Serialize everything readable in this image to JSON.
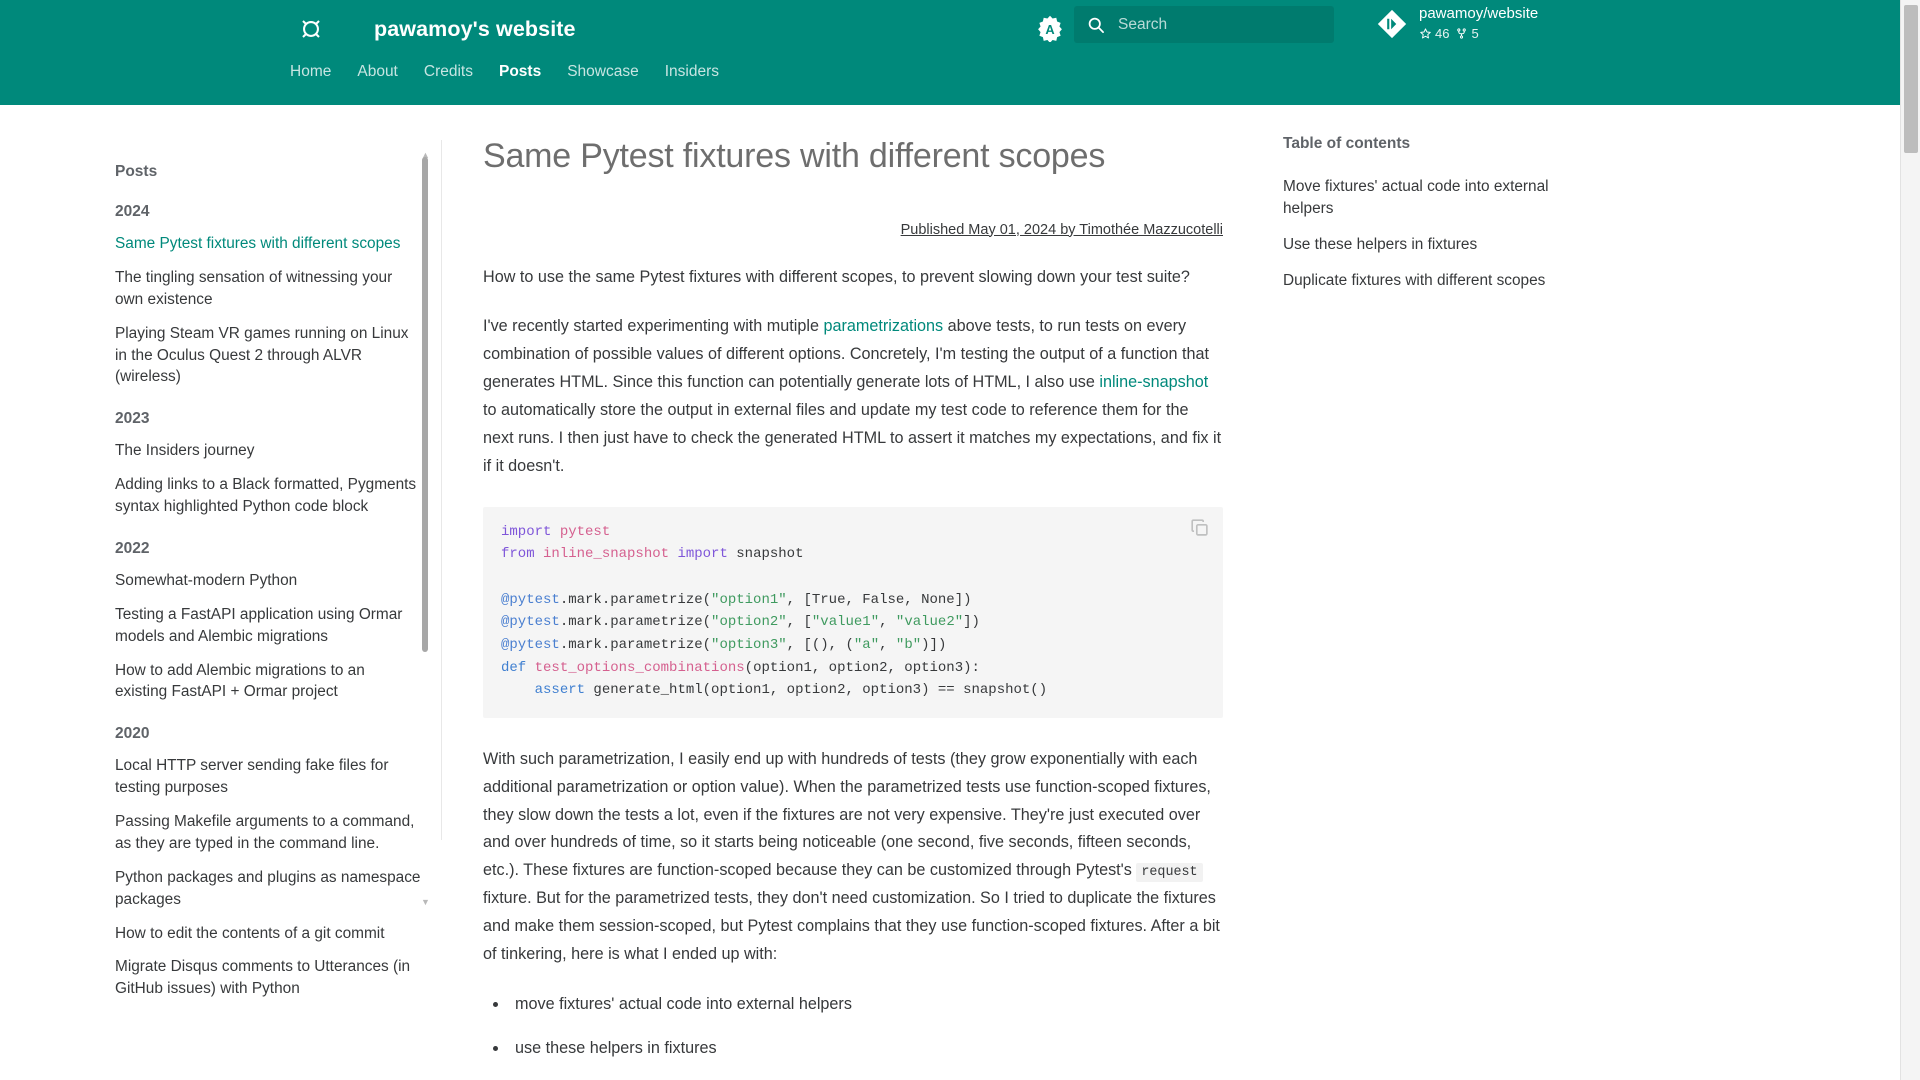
{
  "header": {
    "logo_icon": "site-logo-icon",
    "site_title": "pawamoy's website",
    "theme_toggle_icon": "brightness-auto-icon",
    "search": {
      "icon": "search-icon",
      "placeholder": "Search",
      "value": ""
    },
    "repo": {
      "icon": "git-icon",
      "name": "pawamoy/website",
      "stars_icon": "star-icon",
      "stars": "46",
      "forks_icon": "fork-icon",
      "forks": "5"
    },
    "nav": [
      {
        "label": "Home",
        "active": false
      },
      {
        "label": "About",
        "active": false
      },
      {
        "label": "Credits",
        "active": false
      },
      {
        "label": "Posts",
        "active": true
      },
      {
        "label": "Showcase",
        "active": false
      },
      {
        "label": "Insiders",
        "active": false
      }
    ]
  },
  "sidebar": {
    "title": "Posts",
    "groups": [
      {
        "year": "2024",
        "items": [
          {
            "label": "Same Pytest fixtures with different scopes",
            "current": true
          },
          {
            "label": "The tingling sensation of witnessing your own existence",
            "current": false
          },
          {
            "label": "Playing Steam VR games running on Linux in the Oculus Quest 2 through ALVR (wireless)",
            "current": false
          }
        ]
      },
      {
        "year": "2023",
        "items": [
          {
            "label": "The Insiders journey",
            "current": false
          },
          {
            "label": "Adding links to a Black formatted, Pygments syntax highlighted Python code block",
            "current": false
          }
        ]
      },
      {
        "year": "2022",
        "items": [
          {
            "label": "Somewhat-modern Python",
            "current": false
          },
          {
            "label": "Testing a FastAPI application using Ormar models and Alembic migrations",
            "current": false
          },
          {
            "label": "How to add Alembic migrations to an existing FastAPI + Ormar project",
            "current": false
          }
        ]
      },
      {
        "year": "2020",
        "items": [
          {
            "label": "Local HTTP server sending fake files for testing purposes",
            "current": false
          },
          {
            "label": "Passing Makefile arguments to a command, as they are typed in the command line.",
            "current": false
          },
          {
            "label": "Python packages and plugins as namespace packages",
            "current": false
          },
          {
            "label": "How to edit the contents of a git commit",
            "current": false
          },
          {
            "label": "Migrate Disqus comments to Utterances (in GitHub issues) with Python",
            "current": false
          }
        ]
      }
    ]
  },
  "article": {
    "title": "Same Pytest fixtures with different scopes",
    "byline": "Published May 01, 2024 by Timothée Mazzucotelli",
    "paragraph_1": "How to use the same Pytest fixtures with different scopes, to prevent slowing down your test suite?",
    "paragraph_2_a": "I've recently started experimenting with mutiple ",
    "paragraph_2_link1": "parametrizations",
    "paragraph_2_b": " above tests, to run tests on every combination of possible values of different options. Concretely, I'm testing the output of a function that generates HTML. Since this function can potentially generate lots of HTML, I also use ",
    "paragraph_2_link2": "inline-snapshot",
    "paragraph_2_c": " to automatically store the output in external files and update my test code to reference them for the next runs. I then just have to check the generated HTML to assert it matches my expectations, and fix it if it doesn't.",
    "code": {
      "copy_icon": "copy-icon",
      "lines": [
        "import pytest",
        "from inline_snapshot import snapshot",
        "",
        "@pytest.mark.parametrize(\"option1\", [True, False, None])",
        "@pytest.mark.parametrize(\"option2\", [\"value1\", \"value2\"])",
        "@pytest.mark.parametrize(\"option3\", [(), (\"a\", \"b\")])",
        "def test_options_combinations(option1, option2, option3):",
        "    assert generate_html(option1, option2, option3) == snapshot()"
      ]
    },
    "paragraph_3_a": "With such parametrization, I easily end up with hundreds of tests (they grow exponentially with each additional parametrization or option value). When the parametrized tests use function-scoped fixtures, they slow down the tests a lot, even if the fixtures are not very expensive. They're just executed over and over hundreds of time, so it starts being noticeable (one second, five seconds, fifteen seconds, etc.). These fixtures are function-scoped because they can be customized through Pytest's ",
    "paragraph_3_code": "request",
    "paragraph_3_b": " fixture. But for the parametrized tests, they don't need customization. So I tried to duplicate the fixtures and make them session-scoped, but Pytest complains that they use function-scoped fixtures. After a bit of tinkering, here is what I ended up with:",
    "bullets": [
      "move fixtures' actual code into external helpers",
      "use these helpers in fixtures"
    ]
  },
  "toc": {
    "title": "Table of contents",
    "items": [
      "Move fixtures' actual code into external helpers",
      "Use these helpers in fixtures",
      "Duplicate fixtures with different scopes"
    ]
  },
  "colors": {
    "brand": "#00897b",
    "link": "#00897b",
    "text": "#37393b",
    "muted": "#5f6368",
    "code_bg": "#f5f5f5"
  }
}
